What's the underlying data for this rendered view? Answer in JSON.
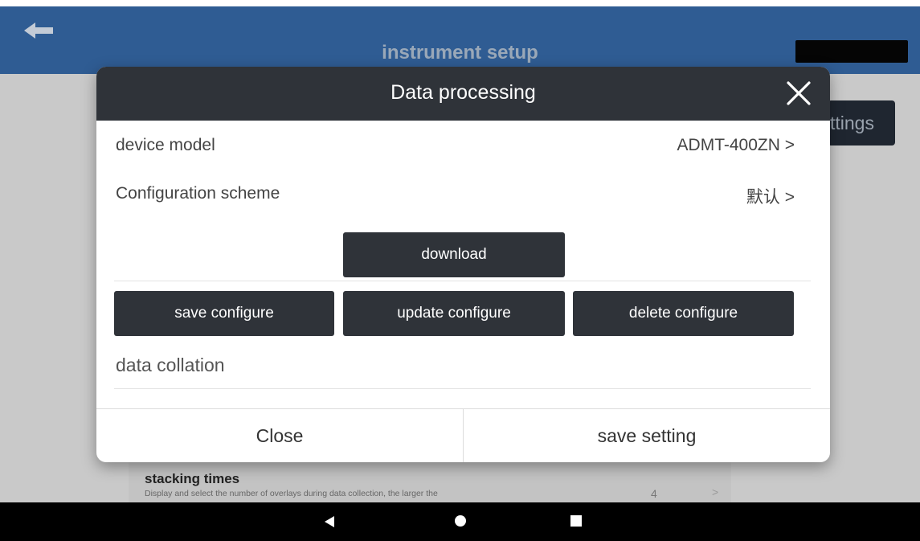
{
  "app": {
    "title": "instrument setup",
    "settings_button_label": "ttings",
    "stacking": {
      "title": "stacking times",
      "description": "Display and select the number of overlays during data collection, the larger the",
      "value": "4",
      "chevron": ">"
    }
  },
  "dialog": {
    "title": "Data processing",
    "device_model": {
      "label": "device model",
      "value": "ADMT-400ZN >"
    },
    "configuration_scheme": {
      "label": "Configuration scheme",
      "value": "默认 >"
    },
    "download_label": "download",
    "save_configure_label": "save configure",
    "update_configure_label": "update configure",
    "delete_configure_label": "delete configure",
    "data_collation_label": "data collation",
    "close_label": "Close",
    "save_setting_label": "save setting"
  },
  "colors": {
    "app_header": "#2f5c93",
    "dialog_header": "#2f3339",
    "button": "#2f3339",
    "overlay_background": "#c9c9c9"
  },
  "icons": {
    "back": "left-arrow-icon",
    "close": "close-x-icon",
    "nav_back": "triangle-back-icon",
    "nav_home": "circle-home-icon",
    "nav_recent": "square-recents-icon"
  }
}
